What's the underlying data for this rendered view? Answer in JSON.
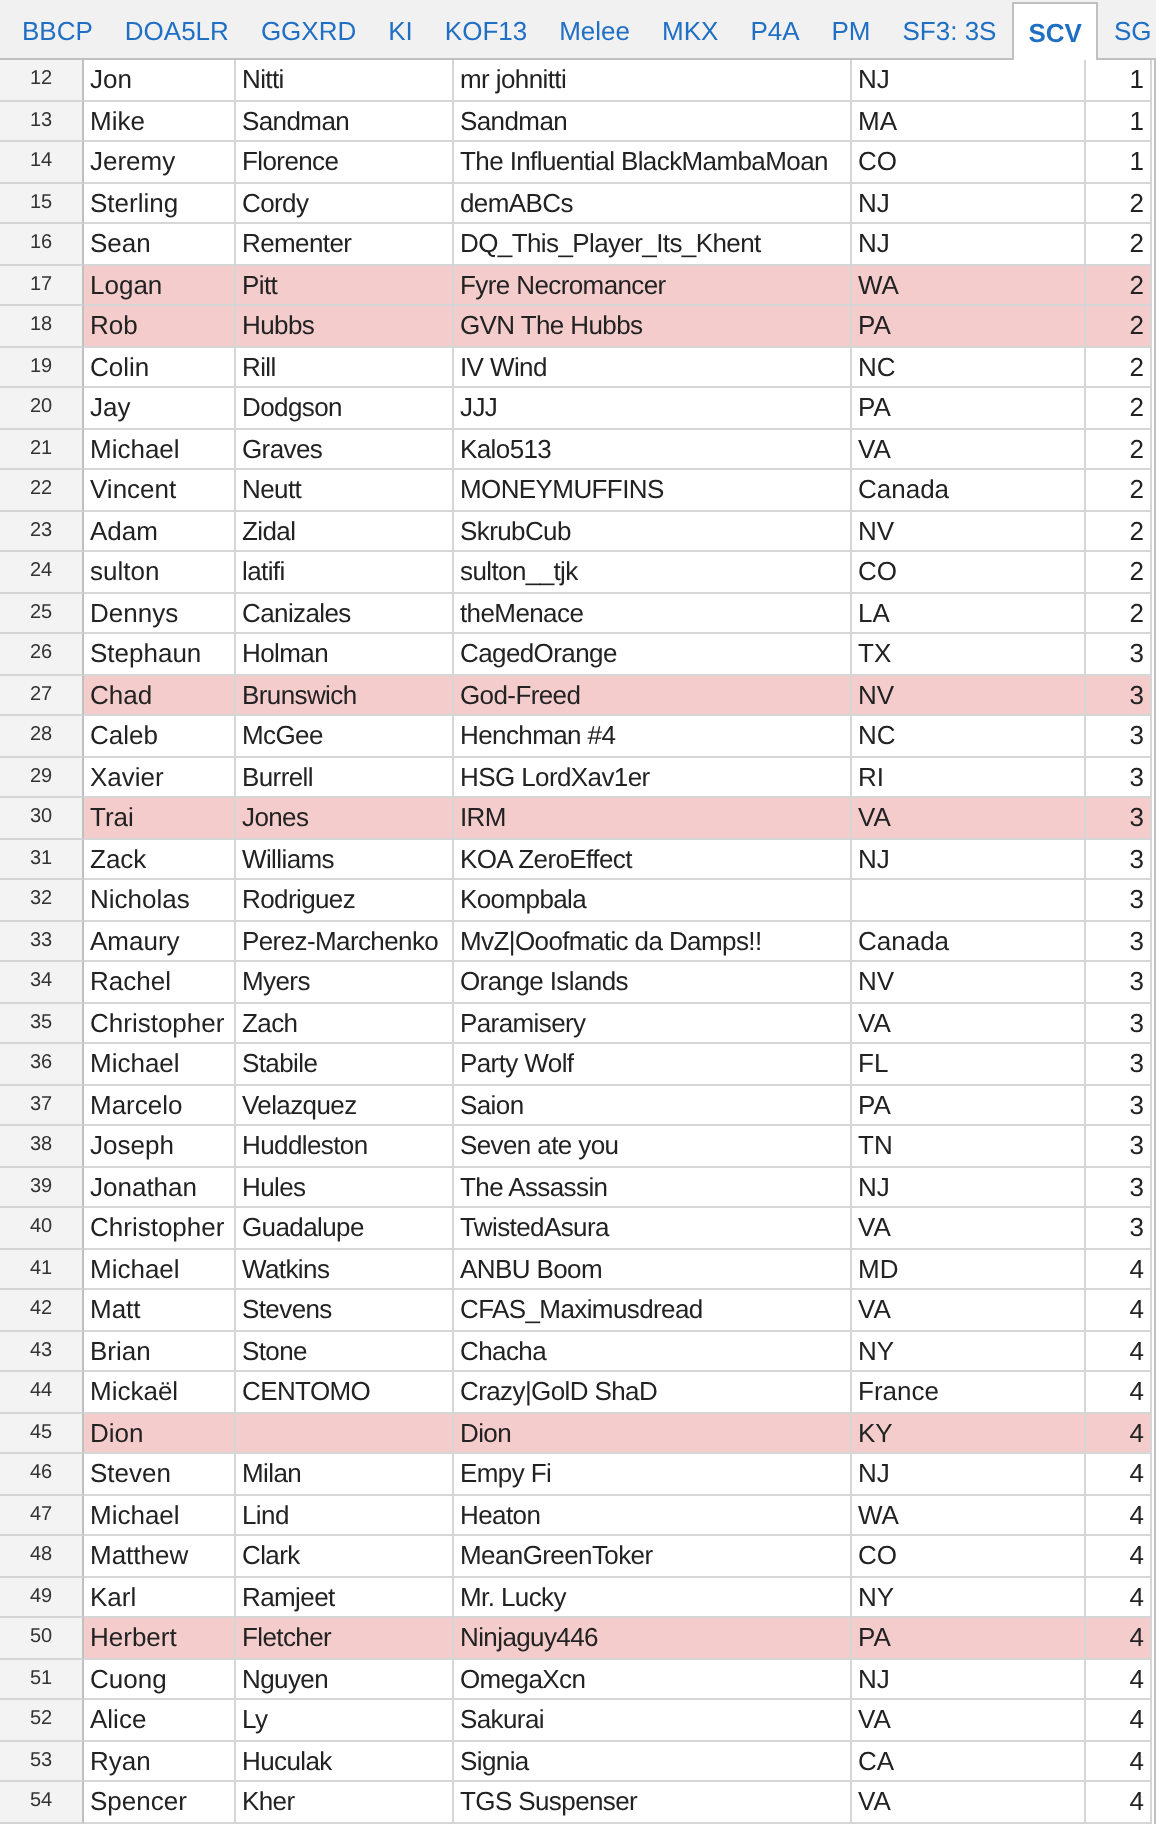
{
  "tabs": [
    {
      "label": "BBCP",
      "selected": false
    },
    {
      "label": "DOA5LR",
      "selected": false
    },
    {
      "label": "GGXRD",
      "selected": false
    },
    {
      "label": "KI",
      "selected": false
    },
    {
      "label": "KOF13",
      "selected": false
    },
    {
      "label": "Melee",
      "selected": false
    },
    {
      "label": "MKX",
      "selected": false
    },
    {
      "label": "P4A",
      "selected": false
    },
    {
      "label": "PM",
      "selected": false
    },
    {
      "label": "SF3: 3S",
      "selected": false
    },
    {
      "label": "SCV",
      "selected": true
    },
    {
      "label": "SG",
      "selected": false
    }
  ],
  "rows": [
    {
      "row_number": "12",
      "column_1": "Jon",
      "column_2": "Nitti",
      "column_3": "mr johnitti",
      "column_4": "NJ",
      "column_5": "1",
      "highlighted": false
    },
    {
      "row_number": "13",
      "column_1": "Mike",
      "column_2": "Sandman",
      "column_3": "Sandman",
      "column_4": "MA",
      "column_5": "1",
      "highlighted": false
    },
    {
      "row_number": "14",
      "column_1": "Jeremy",
      "column_2": "Florence",
      "column_3": "The Influential BlackMambaMoan",
      "column_4": "CO",
      "column_5": "1",
      "highlighted": false
    },
    {
      "row_number": "15",
      "column_1": "Sterling",
      "column_2": "Cordy",
      "column_3": "demABCs",
      "column_4": "NJ",
      "column_5": "2",
      "highlighted": false
    },
    {
      "row_number": "16",
      "column_1": "Sean",
      "column_2": "Rementer",
      "column_3": "DQ_This_Player_Its_Khent",
      "column_4": "NJ",
      "column_5": "2",
      "highlighted": false
    },
    {
      "row_number": "17",
      "column_1": "Logan",
      "column_2": "Pitt",
      "column_3": "Fyre Necromancer",
      "column_4": "WA",
      "column_5": "2",
      "highlighted": true
    },
    {
      "row_number": "18",
      "column_1": "Rob",
      "column_2": "Hubbs",
      "column_3": "GVN The Hubbs",
      "column_4": "PA",
      "column_5": "2",
      "highlighted": true
    },
    {
      "row_number": "19",
      "column_1": "Colin",
      "column_2": "Rill",
      "column_3": "IV Wind",
      "column_4": "NC",
      "column_5": "2",
      "highlighted": false
    },
    {
      "row_number": "20",
      "column_1": "Jay",
      "column_2": "Dodgson",
      "column_3": "JJJ",
      "column_4": "PA",
      "column_5": "2",
      "highlighted": false
    },
    {
      "row_number": "21",
      "column_1": "Michael",
      "column_2": "Graves",
      "column_3": "Kalo513",
      "column_4": "VA",
      "column_5": "2",
      "highlighted": false
    },
    {
      "row_number": "22",
      "column_1": "Vincent",
      "column_2": "Neutt",
      "column_3": "MONEYMUFFINS",
      "column_4": "Canada",
      "column_5": "2",
      "highlighted": false
    },
    {
      "row_number": "23",
      "column_1": "Adam",
      "column_2": "Zidal",
      "column_3": "SkrubCub",
      "column_4": "NV",
      "column_5": "2",
      "highlighted": false
    },
    {
      "row_number": "24",
      "column_1": "sulton",
      "column_2": "latifi",
      "column_3": "sulton__tjk",
      "column_4": "CO",
      "column_5": "2",
      "highlighted": false
    },
    {
      "row_number": "25",
      "column_1": "Dennys",
      "column_2": "Canizales",
      "column_3": "theMenace",
      "column_4": "LA",
      "column_5": "2",
      "highlighted": false
    },
    {
      "row_number": "26",
      "column_1": "Stephaun",
      "column_2": "Holman",
      "column_3": "CagedOrange",
      "column_4": "TX",
      "column_5": "3",
      "highlighted": false
    },
    {
      "row_number": "27",
      "column_1": "Chad",
      "column_2": "Brunswich",
      "column_3": "God-Freed",
      "column_4": "NV",
      "column_5": "3",
      "highlighted": true
    },
    {
      "row_number": "28",
      "column_1": "Caleb",
      "column_2": "McGee",
      "column_3": "Henchman #4",
      "column_4": "NC",
      "column_5": "3",
      "highlighted": false
    },
    {
      "row_number": "29",
      "column_1": "Xavier",
      "column_2": "Burrell",
      "column_3": "HSG LordXav1er",
      "column_4": "RI",
      "column_5": "3",
      "highlighted": false
    },
    {
      "row_number": "30",
      "column_1": "Trai",
      "column_2": "Jones",
      "column_3": "IRM",
      "column_4": "VA",
      "column_5": "3",
      "highlighted": true
    },
    {
      "row_number": "31",
      "column_1": "Zack",
      "column_2": "Williams",
      "column_3": "KOA ZeroEffect",
      "column_4": "NJ",
      "column_5": "3",
      "highlighted": false
    },
    {
      "row_number": "32",
      "column_1": "Nicholas",
      "column_2": "Rodriguez",
      "column_3": "Koompbala",
      "column_5": "3",
      "highlighted": false
    },
    {
      "row_number": "33",
      "column_1": "Amaury",
      "column_2": "Perez-Marchenko",
      "column_3": "MvZ|Ooofmatic da Damps!!",
      "column_4": "Canada",
      "column_5": "3",
      "highlighted": false
    },
    {
      "row_number": "34",
      "column_1": "Rachel",
      "column_2": "Myers",
      "column_3": "Orange Islands",
      "column_4": "NV",
      "column_5": "3",
      "highlighted": false
    },
    {
      "row_number": "35",
      "column_1": "Christopher",
      "column_2": "Zach",
      "column_3": "Paramisery",
      "column_4": "VA",
      "column_5": "3",
      "highlighted": false
    },
    {
      "row_number": "36",
      "column_1": "Michael",
      "column_2": "Stabile",
      "column_3": "Party Wolf",
      "column_4": "FL",
      "column_5": "3",
      "highlighted": false
    },
    {
      "row_number": "37",
      "column_1": "Marcelo",
      "column_2": "Velazquez",
      "column_3": "Saion",
      "column_4": "PA",
      "column_5": "3",
      "highlighted": false
    },
    {
      "row_number": "38",
      "column_1": "Joseph",
      "column_2": "Huddleston",
      "column_3": "Seven ate you",
      "column_4": "TN",
      "column_5": "3",
      "highlighted": false
    },
    {
      "row_number": "39",
      "column_1": "Jonathan",
      "column_2": "Hules",
      "column_3": "The Assassin",
      "column_4": "NJ",
      "column_5": "3",
      "highlighted": false
    },
    {
      "row_number": "40",
      "column_1": "Christopher",
      "column_2": "Guadalupe",
      "column_3": "TwistedAsura",
      "column_4": "VA",
      "column_5": "3",
      "highlighted": false
    },
    {
      "row_number": "41",
      "column_1": "Michael",
      "column_2": "Watkins",
      "column_3": "ANBU Boom",
      "column_4": "MD",
      "column_5": "4",
      "highlighted": false
    },
    {
      "row_number": "42",
      "column_1": "Matt",
      "column_2": "Stevens",
      "column_3": "CFAS_Maximusdread",
      "column_4": "VA",
      "column_5": "4",
      "highlighted": false
    },
    {
      "row_number": "43",
      "column_1": "Brian",
      "column_2": "Stone",
      "column_3": "Chacha",
      "column_4": "NY",
      "column_5": "4",
      "highlighted": false
    },
    {
      "row_number": "44",
      "column_1": "Mickaël",
      "column_2": "CENTOMO",
      "column_3": "Crazy|GolD ShaD",
      "column_4": "France",
      "column_5": "4",
      "highlighted": false
    },
    {
      "row_number": "45",
      "column_1": "Dion",
      "column_3": "Dion",
      "column_4": "KY",
      "column_5": "4",
      "highlighted": true
    },
    {
      "row_number": "46",
      "column_1": "Steven",
      "column_2": "Milan",
      "column_3": "Empy Fi",
      "column_4": "NJ",
      "column_5": "4",
      "highlighted": false
    },
    {
      "row_number": "47",
      "column_1": "Michael",
      "column_2": "Lind",
      "column_3": "Heaton",
      "column_4": "WA",
      "column_5": "4",
      "highlighted": false
    },
    {
      "row_number": "48",
      "column_1": "Matthew",
      "column_2": "Clark",
      "column_3": "MeanGreenToker",
      "column_4": "CO",
      "column_5": "4",
      "highlighted": false
    },
    {
      "row_number": "49",
      "column_1": "Karl",
      "column_2": "Ramjeet",
      "column_3": "Mr. Lucky",
      "column_4": "NY",
      "column_5": "4",
      "highlighted": false
    },
    {
      "row_number": "50",
      "column_1": "Herbert",
      "column_2": "Fletcher",
      "column_3": "Ninjaguy446",
      "column_4": "PA",
      "column_5": "4",
      "highlighted": true
    },
    {
      "row_number": "51",
      "column_1": "Cuong",
      "column_2": "Nguyen",
      "column_3": "OmegaXcn",
      "column_4": "NJ",
      "column_5": "4",
      "highlighted": false
    },
    {
      "row_number": "52",
      "column_1": "Alice",
      "column_2": "Ly",
      "column_3": "Sakurai",
      "column_4": "VA",
      "column_5": "4",
      "highlighted": false
    },
    {
      "row_number": "53",
      "column_1": "Ryan",
      "column_2": "Huculak",
      "column_3": "Signia",
      "column_4": "CA",
      "column_5": "4",
      "highlighted": false
    },
    {
      "row_number": "54",
      "column_1": "Spencer",
      "column_2": "Kher",
      "column_3": "TGS Suspenser",
      "column_4": "VA",
      "column_5": "4",
      "highlighted": false
    }
  ]
}
